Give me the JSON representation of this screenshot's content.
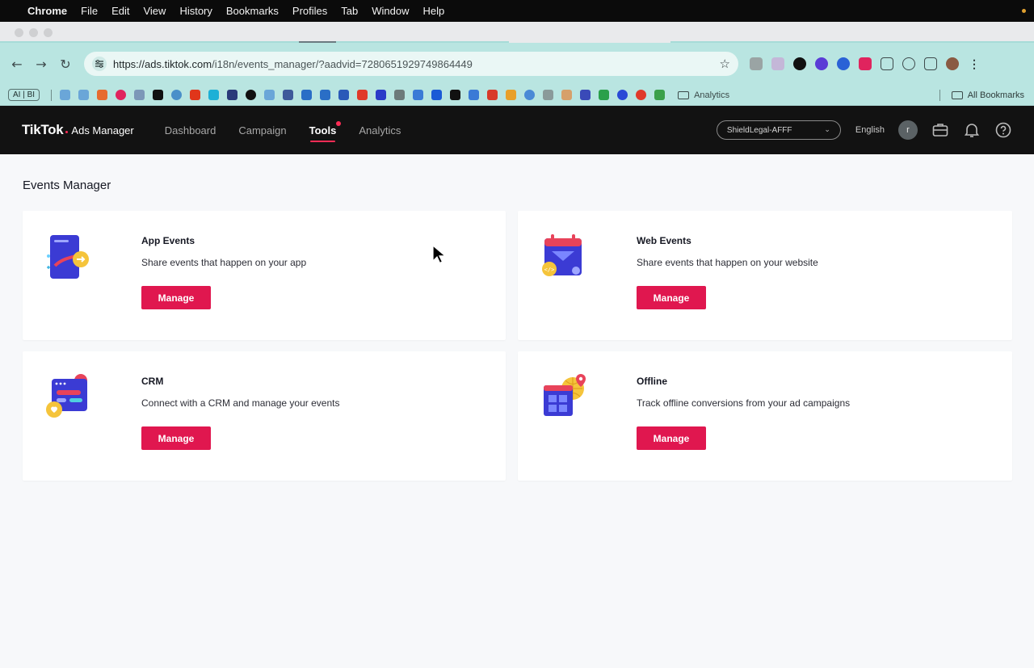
{
  "mac_menu": {
    "apple": "",
    "items": [
      "Chrome",
      "File",
      "Edit",
      "View",
      "History",
      "Bookmarks",
      "Profiles",
      "Tab",
      "Window",
      "Help"
    ]
  },
  "browser": {
    "url_host": "https://ads.tiktok.com",
    "url_path": "/i18n/events_manager/?aadvid=7280651929749864449",
    "bookmarks_first": "AI | BI",
    "bookmark_folder": "Analytics",
    "all_bookmarks": "All Bookmarks",
    "icons": {
      "back": "back-arrow-icon",
      "forward": "forward-arrow-icon",
      "reload": "reload-icon",
      "star": "star-icon"
    }
  },
  "header": {
    "brand": "TikTok",
    "product": "Ads Manager",
    "nav": [
      {
        "label": "Dashboard",
        "active": false
      },
      {
        "label": "Campaign",
        "active": false
      },
      {
        "label": "Tools",
        "active": true
      },
      {
        "label": "Analytics",
        "active": false
      }
    ],
    "account": "ShieldLegal-AFFF",
    "language": "English",
    "avatar_initial": "r",
    "accent": "#fe2c55"
  },
  "page": {
    "title": "Events Manager",
    "cards": [
      {
        "title": "App Events",
        "desc": "Share events that happen on your app",
        "button": "Manage",
        "icon": "app-events-illustration"
      },
      {
        "title": "Web Events",
        "desc": "Share events that happen on your website",
        "button": "Manage",
        "icon": "web-events-illustration"
      },
      {
        "title": "CRM",
        "desc": "Connect with a CRM and manage your events",
        "button": "Manage",
        "icon": "crm-illustration"
      },
      {
        "title": "Offline",
        "desc": "Track offline conversions from your ad campaigns",
        "button": "Manage",
        "icon": "offline-illustration"
      }
    ],
    "button_color": "#e0174f"
  }
}
